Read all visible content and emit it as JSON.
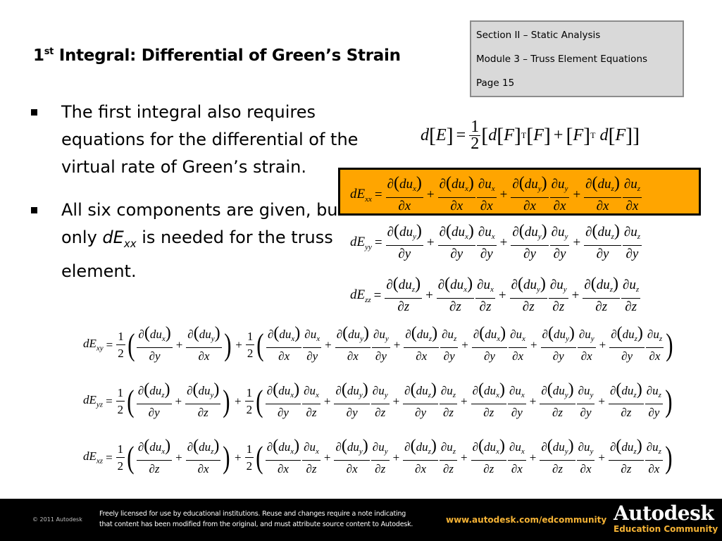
{
  "title": {
    "prefix": "1",
    "sup": "st",
    "rest": " Integral: Differential of Green’s Strain"
  },
  "info_box": {
    "section": "Section II – Static Analysis",
    "module": "Module 3 – Truss Element Equations",
    "page": "Page 15"
  },
  "bullets": [
    {
      "text": "The first integral also requires equations for the differential of the virtual rate of Green’s strain."
    },
    {
      "text_before": "All six components are given, but only ",
      "em": "dE",
      "em_sub": "xx",
      "text_after": " is needed for the truss element."
    }
  ],
  "main_equation": "d[E] = 1/2 [ d[F]^T [F] + [F]^T d[F] ]",
  "highlight_color": "#ffa500",
  "equations": {
    "normal": [
      {
        "lhs_sub": "xx",
        "var": "x",
        "terms": [
          {
            "num": "∂(du",
            "num_sub": "x",
            "den": "∂x"
          },
          {
            "num": "∂(du",
            "num_sub": "x",
            "den": "∂x",
            "num2": "∂u",
            "num2_sub": "x",
            "den2": "∂x"
          },
          {
            "num": "∂(du",
            "num_sub": "y",
            "den": "∂x",
            "num2": "∂u",
            "num2_sub": "y",
            "den2": "∂x"
          },
          {
            "num": "∂(du",
            "num_sub": "z",
            "den": "∂x",
            "num2": "∂u",
            "num2_sub": "z",
            "den2": "∂x"
          }
        ]
      },
      {
        "lhs_sub": "yy",
        "var": "y",
        "terms": [
          {
            "num": "∂(du",
            "num_sub": "y",
            "den": "∂y"
          },
          {
            "num": "∂(du",
            "num_sub": "x",
            "den": "∂y",
            "num2": "∂u",
            "num2_sub": "x",
            "den2": "∂y"
          },
          {
            "num": "∂(du",
            "num_sub": "y",
            "den": "∂y",
            "num2": "∂u",
            "num2_sub": "y",
            "den2": "∂y"
          },
          {
            "num": "∂(du",
            "num_sub": "z",
            "den": "∂y",
            "num2": "∂u",
            "num2_sub": "z",
            "den2": "∂y"
          }
        ]
      },
      {
        "lhs_sub": "zz",
        "var": "z",
        "terms": [
          {
            "num": "∂(du",
            "num_sub": "z",
            "den": "∂z"
          },
          {
            "num": "∂(du",
            "num_sub": "x",
            "den": "∂z",
            "num2": "∂u",
            "num2_sub": "x",
            "den2": "∂z"
          },
          {
            "num": "∂(du",
            "num_sub": "y",
            "den": "∂z",
            "num2": "∂u",
            "num2_sub": "y",
            "den2": "∂z"
          },
          {
            "num": "∂(du",
            "num_sub": "z",
            "den": "∂z",
            "num2": "∂u",
            "num2_sub": "z",
            "den2": "∂z"
          }
        ]
      }
    ],
    "shear": [
      {
        "lhs_sub": "xy",
        "first": [
          {
            "num_sub": "x",
            "den": "∂y"
          },
          {
            "num_sub": "y",
            "den": "∂x"
          }
        ],
        "second": [
          {
            "num_sub": "x",
            "den": "∂x",
            "num2_sub": "x",
            "den2": "∂y"
          },
          {
            "num_sub": "y",
            "den": "∂x",
            "num2_sub": "y",
            "den2": "∂y"
          },
          {
            "num_sub": "z",
            "den": "∂x",
            "num2_sub": "z",
            "den2": "∂y"
          },
          {
            "num_sub": "x",
            "den": "∂y",
            "num2_sub": "x",
            "den2": "∂x"
          },
          {
            "num_sub": "y",
            "den": "∂y",
            "num2_sub": "y",
            "den2": "∂x"
          },
          {
            "num_sub": "z",
            "den": "∂y",
            "num2_sub": "z",
            "den2": "∂x"
          }
        ]
      },
      {
        "lhs_sub": "yz",
        "first": [
          {
            "num_sub": "z",
            "den": "∂y"
          },
          {
            "num_sub": "y",
            "den": "∂z"
          }
        ],
        "second": [
          {
            "num_sub": "x",
            "den": "∂y",
            "num2_sub": "x",
            "den2": "∂z"
          },
          {
            "num_sub": "y",
            "den": "∂y",
            "num2_sub": "y",
            "den2": "∂z"
          },
          {
            "num_sub": "z",
            "den": "∂y",
            "num2_sub": "z",
            "den2": "∂z"
          },
          {
            "num_sub": "x",
            "den": "∂z",
            "num2_sub": "x",
            "den2": "∂y"
          },
          {
            "num_sub": "y",
            "den": "∂z",
            "num2_sub": "y",
            "den2": "∂y"
          },
          {
            "num_sub": "z",
            "den": "∂z",
            "num2_sub": "z",
            "den2": "∂y"
          }
        ]
      },
      {
        "lhs_sub": "xz",
        "first": [
          {
            "num_sub": "x",
            "den": "∂z"
          },
          {
            "num_sub": "z",
            "den": "∂x"
          }
        ],
        "second": [
          {
            "num_sub": "x",
            "den": "∂x",
            "num2_sub": "x",
            "den2": "∂z"
          },
          {
            "num_sub": "y",
            "den": "∂x",
            "num2_sub": "y",
            "den2": "∂z"
          },
          {
            "num_sub": "z",
            "den": "∂x",
            "num2_sub": "z",
            "den2": "∂z"
          },
          {
            "num_sub": "x",
            "den": "∂z",
            "num2_sub": "x",
            "den2": "∂x"
          },
          {
            "num_sub": "y",
            "den": "∂z",
            "num2_sub": "y",
            "den2": "∂x"
          },
          {
            "num_sub": "z",
            "den": "∂z",
            "num2_sub": "z",
            "den2": "∂x"
          }
        ]
      }
    ]
  },
  "footer": {
    "copyright": "© 2011 Autodesk",
    "license_line1": "Freely licensed for use by educational institutions. Reuse and changes require a note indicating",
    "license_line2": "that content has been modified from the original, and must attribute source content to Autodesk.",
    "url": "www.autodesk.com/edcommunity",
    "brand": "Autodesk",
    "brand_sub": "Education Community"
  }
}
